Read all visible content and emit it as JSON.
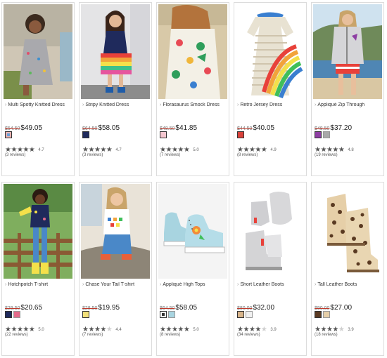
{
  "products": [
    {
      "name": "Multi Spotty Knitted Dress",
      "was": "$54.50",
      "price": "$49.05",
      "rating": 4.7,
      "score": "4.7",
      "reviews": "(3 reviews)",
      "swatches": [
        {
          "color": "#e8b4b4",
          "inner": "#6aa0d8"
        }
      ],
      "icon": "dress-photo"
    },
    {
      "name": "Stripy Knitted Dress",
      "was": "$64.50",
      "price": "$58.05",
      "rating": 4.7,
      "score": "4.7",
      "reviews": "(3 reviews)",
      "swatches": [
        {
          "color": "#1f2a5c"
        }
      ],
      "icon": "dress-photo"
    },
    {
      "name": "Florasaurus Smock Dress",
      "was": "$48.50",
      "price": "$41.85",
      "rating": 5.0,
      "score": "5.0",
      "reviews": "(7 reviews)",
      "swatches": [
        {
          "color": "#f4c6cf"
        }
      ],
      "icon": "dress-photo"
    },
    {
      "name": "Retro Jersey Dress",
      "was": "$44.50",
      "price": "$40.05",
      "rating": 4.9,
      "score": "4.9",
      "reviews": "(8 reviews)",
      "swatches": [
        {
          "color": "#d9413a"
        }
      ],
      "icon": "dress-photo"
    },
    {
      "name": "Appliqué Zip Through",
      "was": "$48.50",
      "price": "$37.20",
      "rating": 4.8,
      "score": "4.8",
      "reviews": "(19 reviews)",
      "swatches": [
        {
          "color": "#8e3ea3"
        },
        {
          "color": "#a9a9a9"
        }
      ],
      "icon": "jacket-photo"
    },
    {
      "name": "Hotchpotch T-shirt",
      "was": "$29.50",
      "price": "$20.65",
      "rating": 5.0,
      "score": "5.0",
      "reviews": "(22 reviews)",
      "swatches": [
        {
          "color": "#1f2a5c"
        },
        {
          "color": "#e46a8a"
        }
      ],
      "icon": "tshirt-photo"
    },
    {
      "name": "Chase Your Tail T-shirt",
      "was": "$28.50",
      "price": "$19.95",
      "rating": 4.4,
      "score": "4.4",
      "reviews": "(7 reviews)",
      "swatches": [
        {
          "color": "#f2e07a"
        }
      ],
      "icon": "tshirt-photo"
    },
    {
      "name": "Appliqué High Tops",
      "was": "$64.50",
      "price": "$58.05",
      "rating": 5.0,
      "score": "5.0",
      "reviews": "(8 reviews)",
      "swatches": [
        {
          "color": "#ffffff",
          "inner": "#333333"
        },
        {
          "color": "#a8d4e0"
        }
      ],
      "icon": "shoe-photo"
    },
    {
      "name": "Short Leather Boots",
      "was": "$80.00",
      "price": "$32.00",
      "rating": 3.9,
      "score": "3.9",
      "reviews": "(34 reviews)",
      "swatches": [
        {
          "color": "#d8b48a"
        },
        {
          "color": "#f0f0f0"
        }
      ],
      "icon": "boot-photo"
    },
    {
      "name": "Tall Leather Boots",
      "was": "$90.00",
      "price": "$27.00",
      "rating": 3.9,
      "score": "3.9",
      "reviews": "(18 reviews)",
      "swatches": [
        {
          "color": "#5a3a22"
        },
        {
          "color": "#e6cfa8"
        }
      ],
      "icon": "boot-photo"
    }
  ],
  "colors": {
    "border": "#dcdcdc",
    "strike": "#c0392b",
    "star": "#555555",
    "star_off": "#cfcfcf"
  }
}
